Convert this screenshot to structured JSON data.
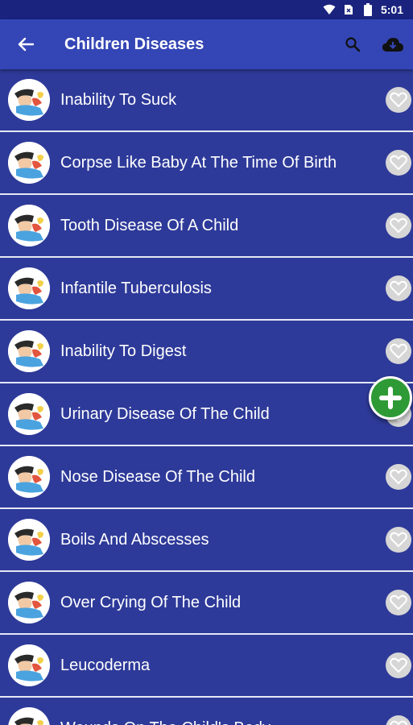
{
  "status_bar": {
    "time": "5:01"
  },
  "app_bar": {
    "title": "Children Diseases"
  },
  "list": {
    "items": [
      {
        "label": "Inability To Suck"
      },
      {
        "label": "Corpse Like Baby At The Time Of Birth"
      },
      {
        "label": "Tooth Disease Of A Child"
      },
      {
        "label": "Infantile Tuberculosis"
      },
      {
        "label": "Inability To Digest"
      },
      {
        "label": "Urinary Disease Of The Child"
      },
      {
        "label": "Nose Disease Of The Child"
      },
      {
        "label": "Boils And Abscesses"
      },
      {
        "label": "Over Crying Of The Child"
      },
      {
        "label": "Leucoderma"
      },
      {
        "label": "Wounds On The Child's Body"
      }
    ]
  },
  "colors": {
    "status_bar": "#1a237e",
    "app_bar": "#3446b5",
    "list_bg": "#2e3a99",
    "fab": "#2e9a35"
  }
}
